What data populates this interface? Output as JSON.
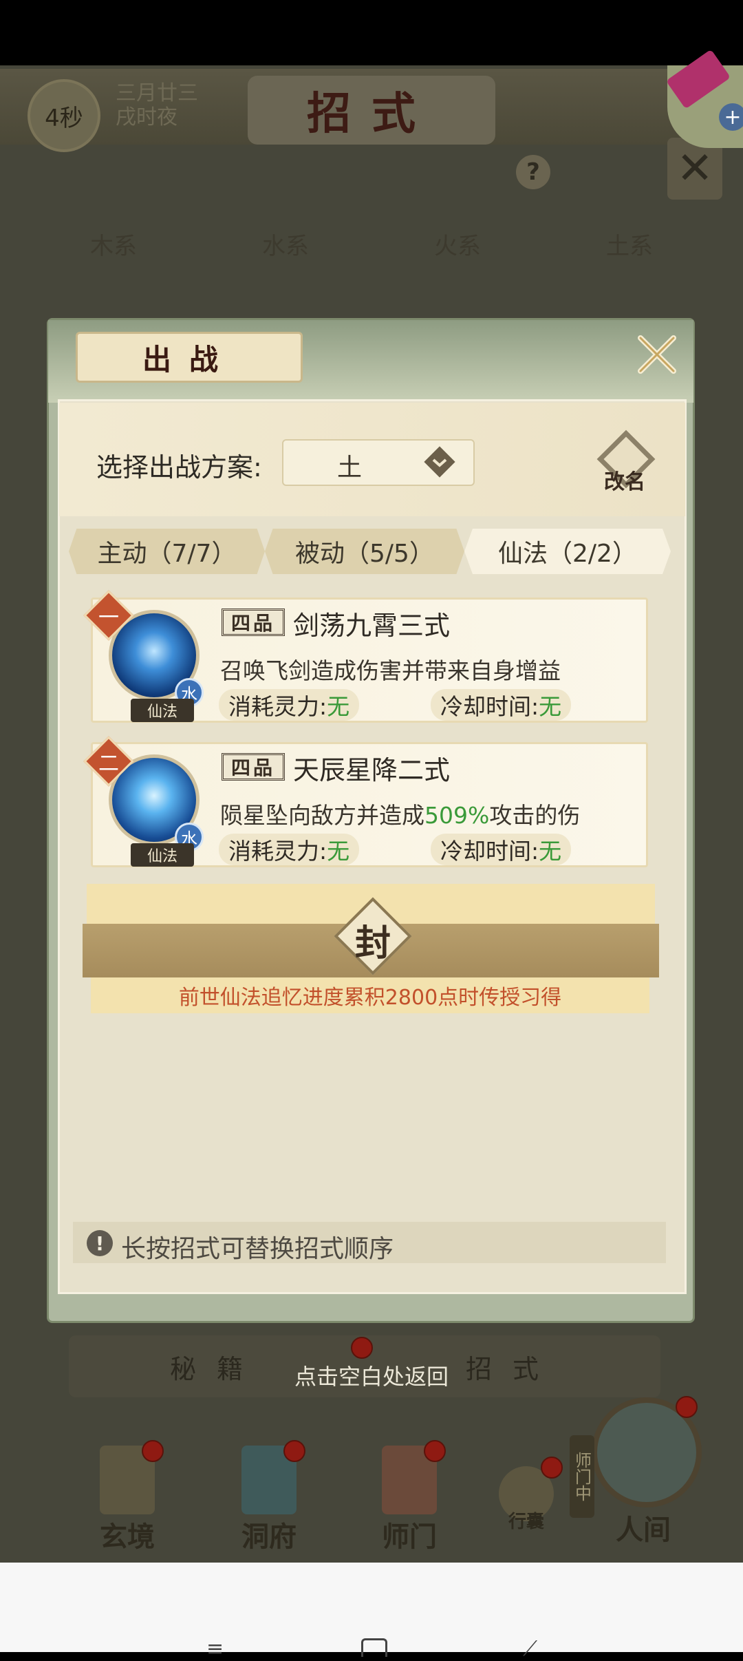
{
  "background": {
    "timer": "4秒",
    "date_line1": "三月廿三",
    "date_line2": "戌时夜",
    "screen_title": "招式",
    "help": "?",
    "element_tabs": [
      "木系",
      "水系",
      "火系",
      "土系"
    ],
    "bottom_tabs": [
      "秘籍",
      "招式"
    ],
    "back_hint": "点击空白处返回",
    "nav": [
      {
        "label": "玄境",
        "icon": "scroll-icon"
      },
      {
        "label": "洞府",
        "icon": "pavilion-icon"
      },
      {
        "label": "师门",
        "icon": "banner-icon"
      },
      {
        "label": "行囊",
        "icon": "bag-icon"
      },
      {
        "label": "人间",
        "icon": "landscape-icon"
      }
    ],
    "shimen_tag": "师门中"
  },
  "dialog": {
    "title": "出战",
    "scheme_label": "选择出战方案:",
    "scheme_value": "土",
    "rename_label": "改名",
    "tabs": [
      {
        "label": "主动（7/7）",
        "active": false
      },
      {
        "label": "被动（5/5）",
        "active": false
      },
      {
        "label": "仙法（2/2）",
        "active": true
      }
    ],
    "skills": [
      {
        "rank": "一",
        "grade": "四品",
        "name": "剑荡九霄三式",
        "description_pre": "召唤飞剑造成伤害并带来自身增益",
        "description_highlight": "",
        "description_post": "",
        "element": "水",
        "type": "仙法",
        "cost_label": "消耗灵力:",
        "cost_value": "无",
        "cooldown_label": "冷却时间:",
        "cooldown_value": "无"
      },
      {
        "rank": "二",
        "grade": "四品",
        "name": "天辰星降二式",
        "description_pre": "陨星坠向敌方并造成",
        "description_highlight": "509%",
        "description_post": "攻击的伤",
        "element": "水",
        "type": "仙法",
        "cost_label": "消耗灵力:",
        "cost_value": "无",
        "cooldown_label": "冷却时间:",
        "cooldown_value": "无"
      }
    ],
    "sealed": {
      "seal_char": "封",
      "hint": "前世仙法追忆进度累积2800点时传授习得"
    },
    "tip": "长按招式可替换招式顺序"
  },
  "colors": {
    "green_value": "#3a9a39",
    "sealed_hint": "#c2502b",
    "dialog_green": "#aeb8a0"
  }
}
